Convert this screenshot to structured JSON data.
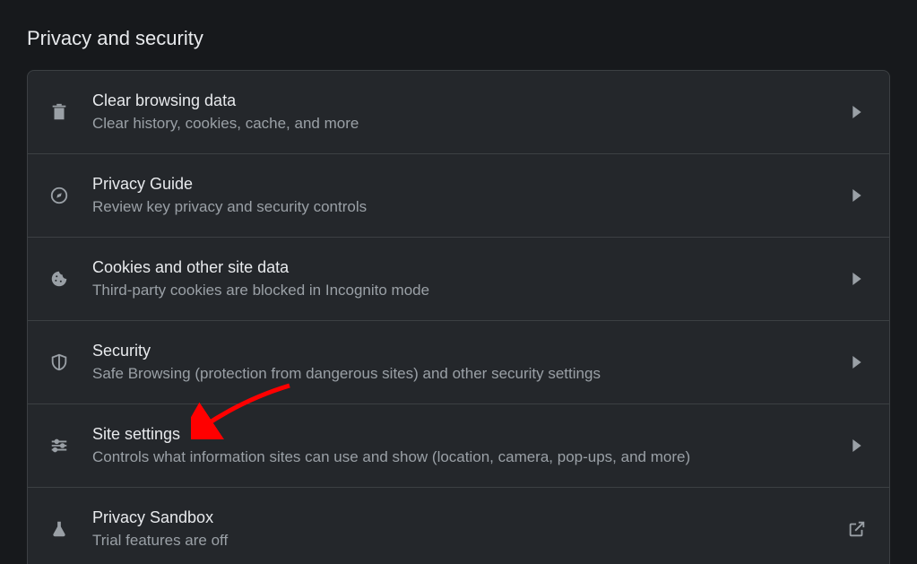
{
  "section_title": "Privacy and security",
  "items": [
    {
      "title": "Clear browsing data",
      "sub": "Clear history, cookies, cache, and more"
    },
    {
      "title": "Privacy Guide",
      "sub": "Review key privacy and security controls"
    },
    {
      "title": "Cookies and other site data",
      "sub": "Third-party cookies are blocked in Incognito mode"
    },
    {
      "title": "Security",
      "sub": "Safe Browsing (protection from dangerous sites) and other security settings"
    },
    {
      "title": "Site settings",
      "sub": "Controls what information sites can use and show (location, camera, pop-ups, and more)"
    },
    {
      "title": "Privacy Sandbox",
      "sub": "Trial features are off"
    }
  ],
  "annotation": {
    "type": "arrow",
    "target": "site-settings-row",
    "color": "#ff0000"
  }
}
